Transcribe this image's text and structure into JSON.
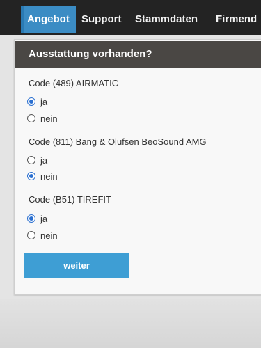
{
  "nav": {
    "tabs": [
      {
        "label": "Angebot",
        "active": true
      },
      {
        "label": "Support",
        "active": false
      },
      {
        "label": "Stammdaten",
        "active": false
      },
      {
        "label": "Firmend",
        "active": false
      }
    ]
  },
  "form": {
    "title": "Ausstattung vorhanden?",
    "questions": [
      {
        "label": "Code (489) AIRMATIC",
        "options": [
          "ja",
          "nein"
        ],
        "selected": "ja"
      },
      {
        "label": "Code (811) Bang & Olufsen BeoSound AMG",
        "options": [
          "ja",
          "nein"
        ],
        "selected": "nein"
      },
      {
        "label": "Code (B51) TIREFIT",
        "options": [
          "ja",
          "nein"
        ],
        "selected": "ja"
      }
    ],
    "submit_label": "weiter"
  },
  "colors": {
    "nav_bg": "#232323",
    "active_tab": "#3b8cc4",
    "header_bg": "#4a4744",
    "radio_checked": "#2a6fd0",
    "button": "#3e9ed4"
  }
}
